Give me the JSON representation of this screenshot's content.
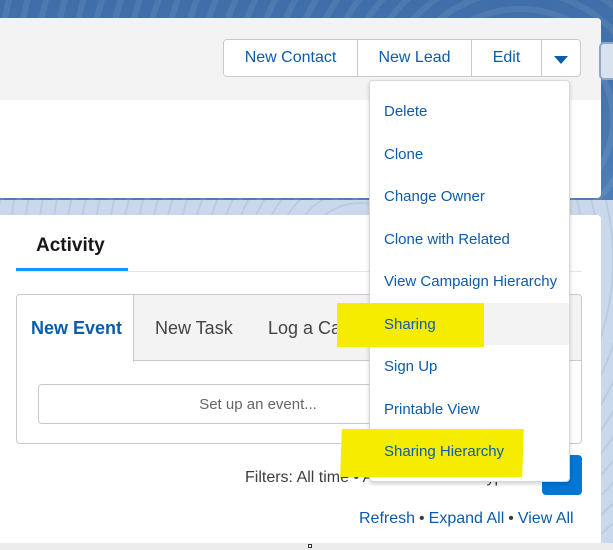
{
  "header": {
    "buttons": {
      "new_contact": "New Contact",
      "new_lead": "New Lead",
      "edit": "Edit"
    },
    "dropdown_icon": "chevron-down-icon"
  },
  "menu": {
    "items": [
      "Delete",
      "Clone",
      "Change Owner",
      "Clone with Related",
      "View Campaign Hierarchy",
      "Sharing",
      "Sign Up",
      "Printable View",
      "Sharing Hierarchy"
    ],
    "highlighted": [
      "Sharing",
      "Sharing Hierarchy"
    ],
    "highlight_color": "#f5ec00"
  },
  "activity": {
    "tab_label": "Activity",
    "composer_tabs": [
      "New Event",
      "New Task",
      "Log a Call"
    ],
    "event_placeholder": "Set up an event...",
    "filters_text": "Filters: All time • All activities • All types",
    "links": [
      "Refresh",
      "Expand All",
      "View All"
    ]
  },
  "colors": {
    "link": "#0b5cab",
    "brand_button": "#0176d3",
    "tab_underline": "#1b96ff"
  }
}
